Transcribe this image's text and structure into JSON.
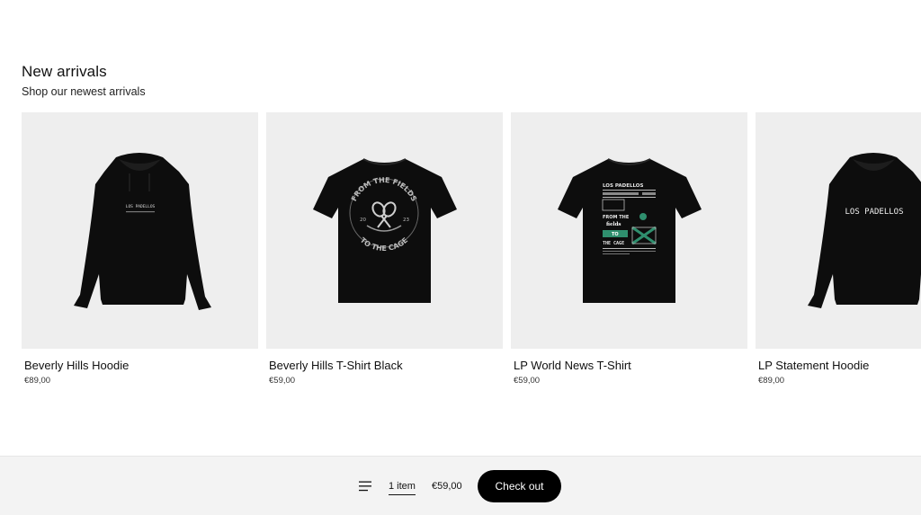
{
  "section": {
    "title": "New arrivals",
    "subtitle": "Shop our newest arrivals"
  },
  "products": [
    {
      "name": "Beverly Hills Hoodie",
      "price": "€89,00",
      "image": "black-hoodie-icon",
      "print": "LOS PADELLOS"
    },
    {
      "name": "Beverly Hills T-Shirt Black",
      "price": "€59,00",
      "image": "black-tshirt-icon",
      "print_top": "FROM THE FIELDS",
      "print_bottom": "TO THE CAGE",
      "print_left": "20",
      "print_right": "23"
    },
    {
      "name": "LP World News T-Shirt",
      "price": "€59,00",
      "image": "black-tshirt-icon",
      "print_header": "LOS PADELLOS",
      "print_lines": [
        "FROM THE",
        "fields",
        "TO",
        "THE CAGE"
      ]
    },
    {
      "name": "LP Statement Hoodie",
      "price": "€89,00",
      "image": "black-hoodie-icon",
      "print": "LOS PADELLOS"
    }
  ],
  "cart_bar": {
    "item_count": "1 item",
    "total": "€59,00",
    "checkout_label": "Check out",
    "menu_icon": "hamburger-menu-icon"
  },
  "colors": {
    "card_background": "#eeeeee",
    "garment": "#0d0d0d",
    "print_accent": "#2f8f6e",
    "button": "#000000",
    "bar_background": "#f3f3f3"
  }
}
